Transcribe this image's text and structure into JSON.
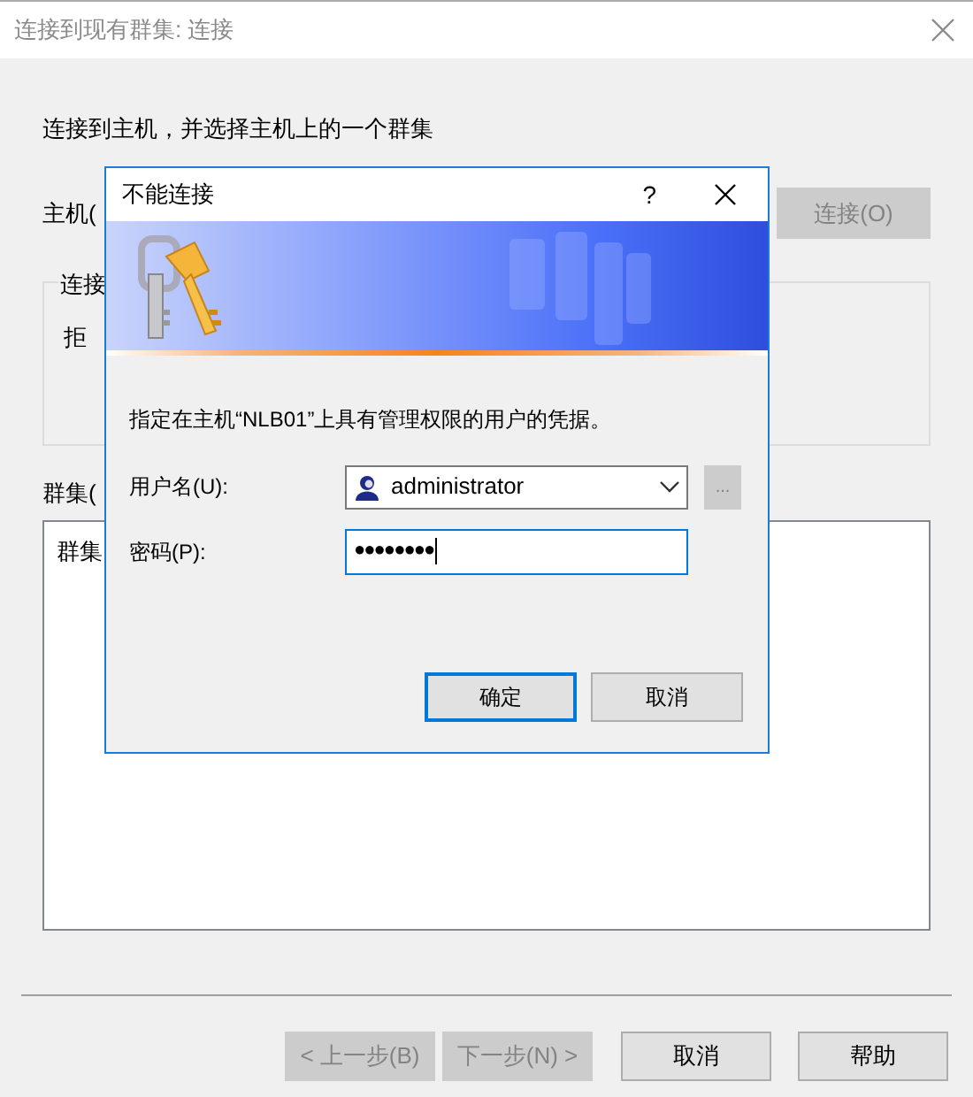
{
  "window": {
    "title": "连接到现有群集: 连接"
  },
  "instruction": "连接到主机，并选择主机上的一个群集",
  "host": {
    "label": "主机(",
    "connect_button": {
      "label": "连接(O)",
      "disabled": true
    }
  },
  "status_group": {
    "label": "连接",
    "text": "拒"
  },
  "clusters": {
    "label": "群集(",
    "header": "群集"
  },
  "wizard_buttons": [
    {
      "label": "< 上一步(B)",
      "disabled": true
    },
    {
      "label": "下一步(N) >",
      "disabled": true
    },
    {
      "label": "取消",
      "disabled": false
    },
    {
      "label": "帮助",
      "disabled": false
    }
  ],
  "dialog": {
    "title": "不能连接",
    "help": "?",
    "message": "指定在主机“NLB01”上具有管理权限的用户的凭据。",
    "username": {
      "label": "用户名(U):",
      "value": "administrator",
      "browse": {
        "label": "...",
        "disabled": true
      }
    },
    "password": {
      "label": "密码(P):",
      "value": "●●●●●●●●",
      "focused": true
    },
    "buttons": [
      {
        "label": "确定",
        "default": true
      },
      {
        "label": "取消",
        "default": false
      }
    ]
  }
}
